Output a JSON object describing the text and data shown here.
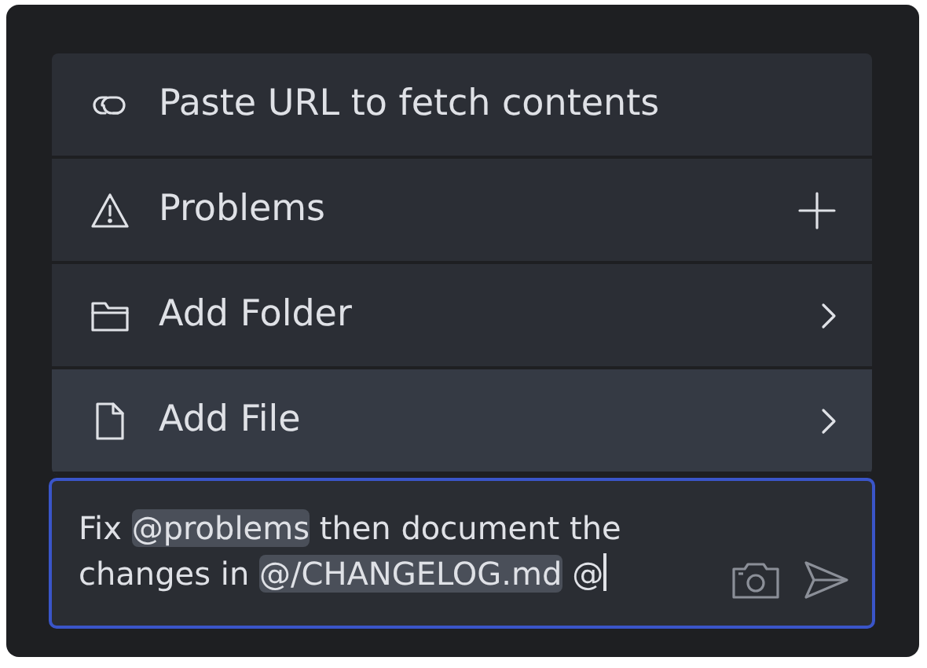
{
  "menu": {
    "items": [
      {
        "kind": "url",
        "label": "Paste URL to fetch contents",
        "selected": false
      },
      {
        "kind": "problems",
        "label": "Problems",
        "selected": false
      },
      {
        "kind": "folder",
        "label": "Add Folder",
        "selected": false
      },
      {
        "kind": "file",
        "label": "Add File",
        "selected": true
      }
    ]
  },
  "input": {
    "focused": true,
    "segments": [
      {
        "kind": "text",
        "text": "Fix "
      },
      {
        "kind": "mention",
        "text": "@problems"
      },
      {
        "kind": "text",
        "text": " then document the changes in "
      },
      {
        "kind": "mention",
        "text": "@/CHANGELOG.md"
      },
      {
        "kind": "text",
        "text": " @"
      }
    ]
  }
}
